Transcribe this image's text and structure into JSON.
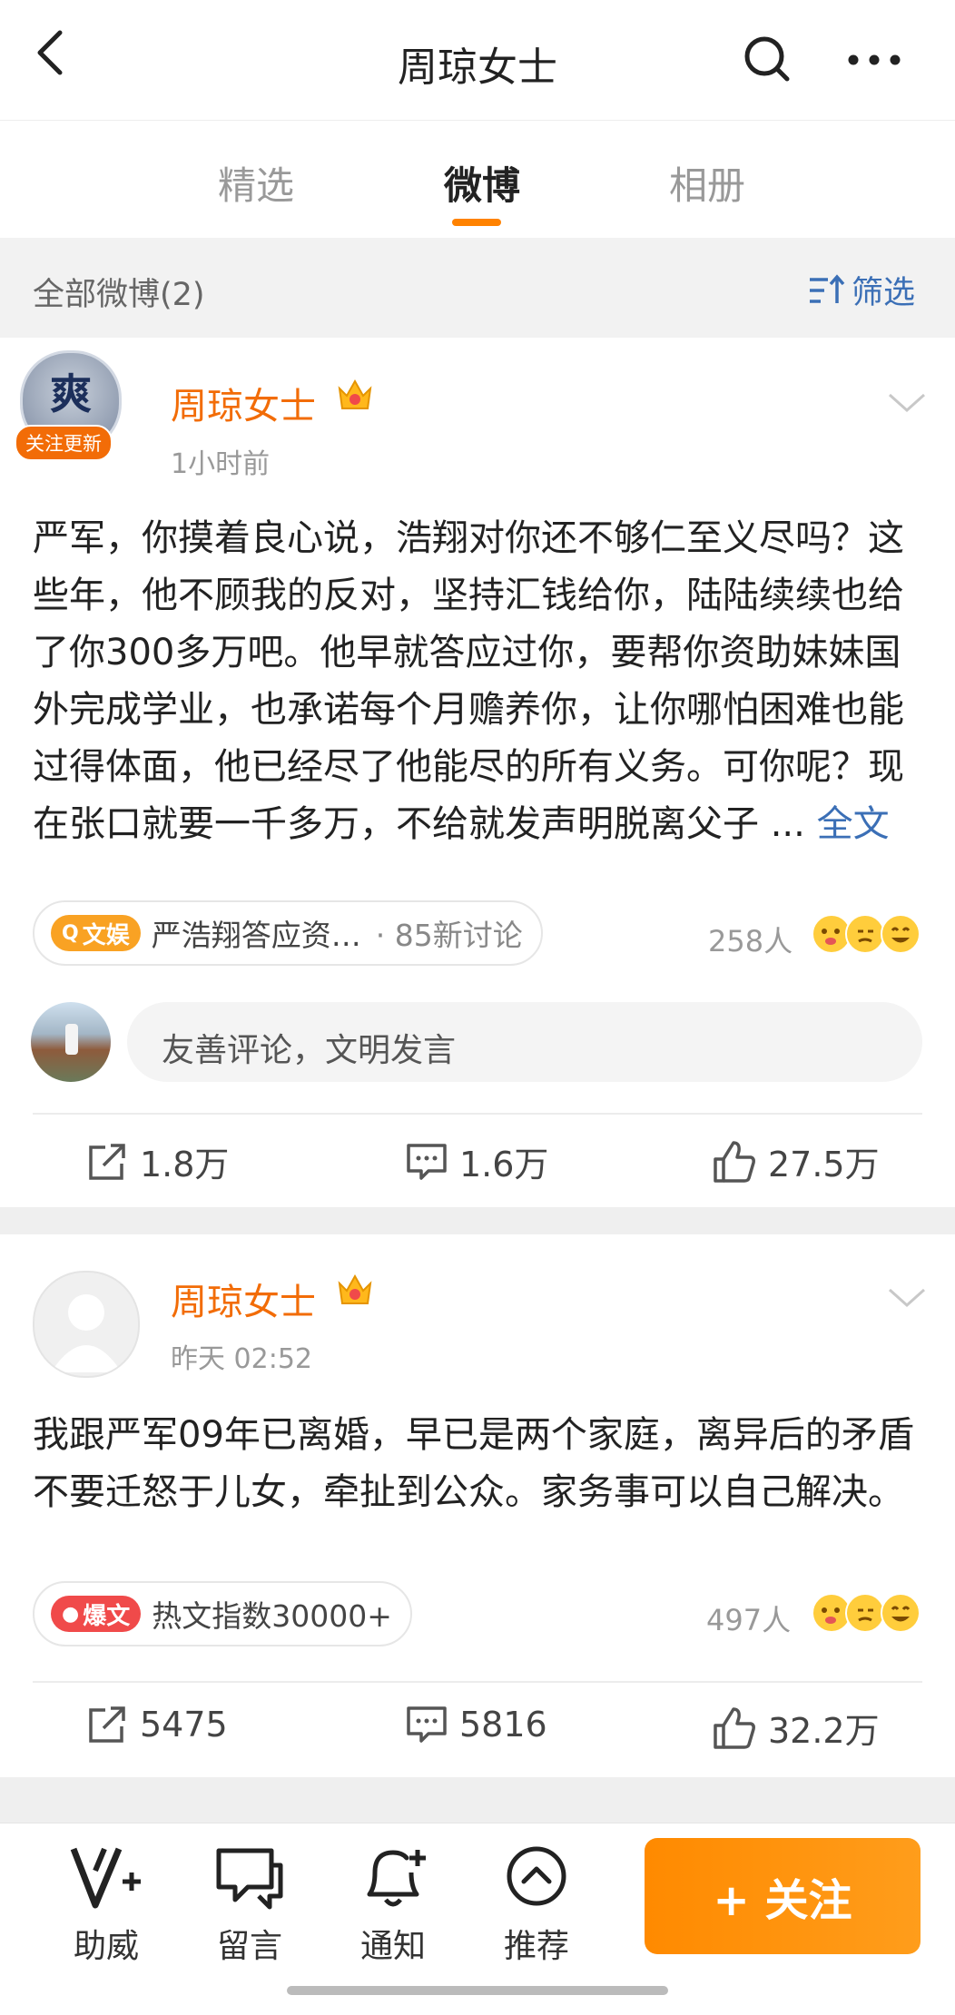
{
  "header": {
    "title": "周琼女士"
  },
  "tabs": [
    {
      "label": "精选"
    },
    {
      "label": "微博"
    },
    {
      "label": "相册"
    }
  ],
  "filter": {
    "count_label": "全部微博(2)",
    "filter_label": "筛选"
  },
  "posts": [
    {
      "author": "周琼女士",
      "avatar_badge": "关注更新",
      "time": "1小时前",
      "text": "严军，你摸着良心说，浩翔对你还不够仁至义尽吗？这些年，他不顾我的反对，坚持汇钱给你，陆陆续续也给了你300多万吧。他早就答应过你，要帮你资助妹妹国外完成学业，也承诺每个月赡养你，让你哪怕困难也能过得体面，他已经尽了他能尽的所有义务。可你呢？现在张口就要一千多万，不给就发声明脱离父子 ...",
      "expand_label": "全文",
      "topic_tag": "文娱",
      "topic_text": "严浩翔答应资…",
      "topic_extra": "· 85新讨论",
      "reaction_count": "258人",
      "comment_placeholder": "友善评论，文明发言",
      "actions": {
        "repost": "1.8万",
        "comment": "1.6万",
        "like": "27.5万"
      }
    },
    {
      "author": "周琼女士",
      "time": "昨天 02:52",
      "text": "我跟严军09年已离婚，早已是两个家庭，离异后的矛盾不要迁怒于儿女，牵扯到公众。家务事可以自己解决。",
      "topic_tag": "爆文",
      "topic_text": "热文指数30000+",
      "reaction_count": "497人",
      "actions": {
        "repost": "5475",
        "comment": "5816",
        "like": "32.2万"
      }
    }
  ],
  "bottom_bar": {
    "items": [
      {
        "label": "助威"
      },
      {
        "label": "留言"
      },
      {
        "label": "通知"
      },
      {
        "label": "推荐"
      }
    ],
    "follow_label": "+ 关注"
  },
  "colors": {
    "accent": "#ff8200",
    "name": "#f26c07",
    "link": "#3b6fb6"
  }
}
